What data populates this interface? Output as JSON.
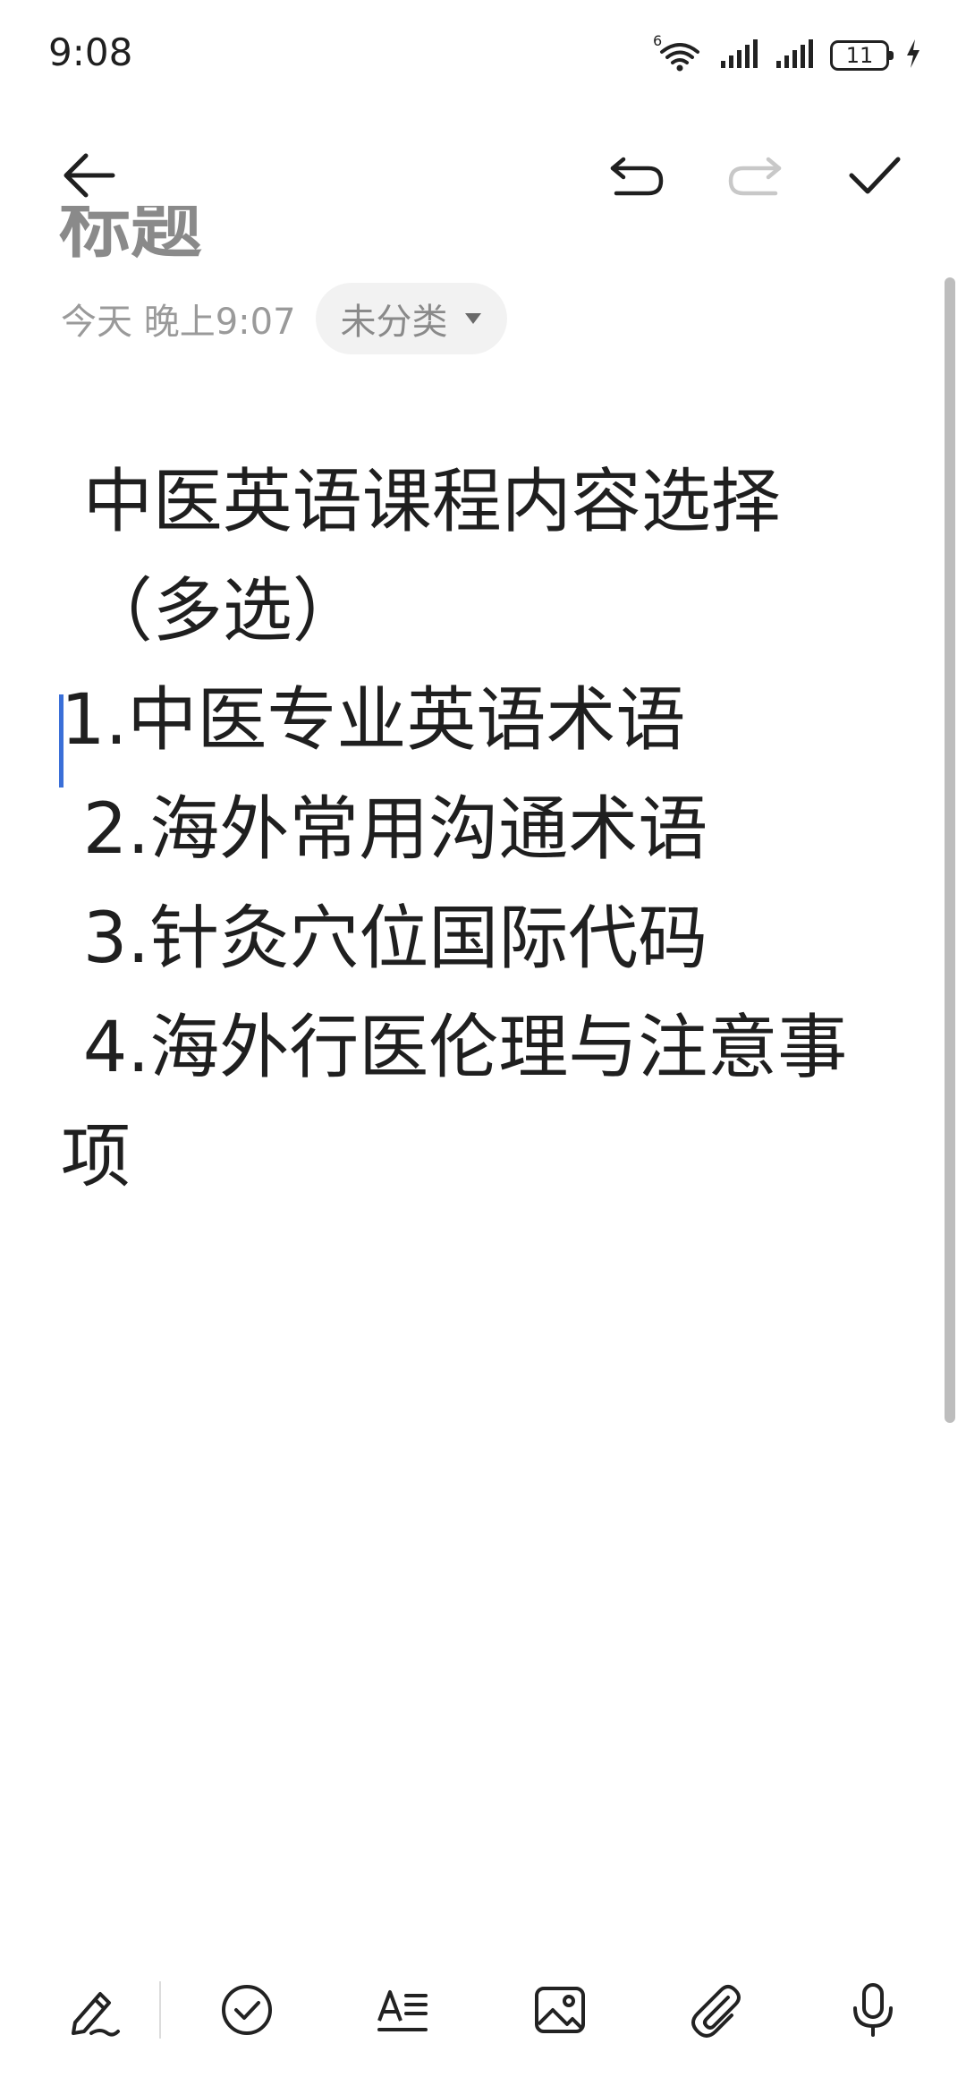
{
  "status_bar": {
    "time": "9:08",
    "network_label": "6",
    "battery_level": "11"
  },
  "toolbar": {
    "icons": [
      "back-arrow-icon",
      "undo-icon",
      "redo-icon",
      "checkmark-icon"
    ]
  },
  "note": {
    "title_partial": "标题",
    "date": "今天 晚上9:07",
    "category": "未分类",
    "content_lines": [
      " 中医英语课程内容选择",
      " （多选）",
      "",
      "1.中医专业英语术语",
      " 2.海外常用沟通术语",
      " 3.针灸穴位国际代码",
      " 4.海外行医伦理与注意事",
      "项"
    ]
  },
  "bottom_bar": {
    "icons": [
      "pen-icon",
      "checklist-icon",
      "text-format-icon",
      "image-icon",
      "attachment-icon",
      "microphone-icon"
    ]
  },
  "colors": {
    "accent": "#3a6fd8",
    "text": "#1f1f1f",
    "muted": "#9a9a9a",
    "chip_bg": "#f2f2f2"
  }
}
